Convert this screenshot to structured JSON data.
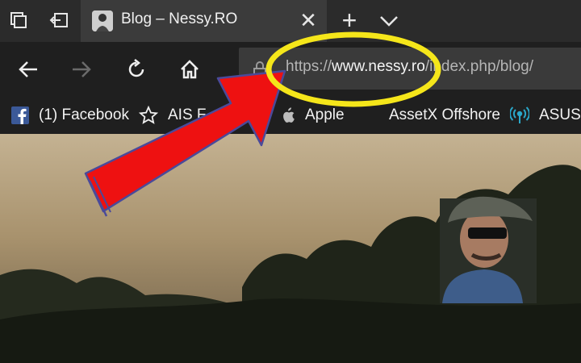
{
  "titlebar": {
    "tab": {
      "title": "Blog – Nessy.RO",
      "close_glyph": "✕"
    },
    "new_tab_glyph": "+"
  },
  "address_bar": {
    "url_scheme": "https://",
    "url_domain": "www.nessy.ro",
    "url_path": "/index.php/blog/"
  },
  "favorites": [
    {
      "label": "(1) Facebook",
      "icon": "facebook-icon"
    },
    {
      "label": "AIS F",
      "icon": "star-icon"
    },
    {
      "label": "Apple",
      "icon": "apple-icon"
    },
    {
      "label": "AssetX Offshore",
      "icon": "assetx-icon"
    },
    {
      "label": "ASUS",
      "icon": "antenna-icon"
    }
  ],
  "annotation": {
    "highlight_color": "#f5e61a",
    "arrow_color": "#ee1111",
    "arrow_outline": "#4a4a9a"
  }
}
